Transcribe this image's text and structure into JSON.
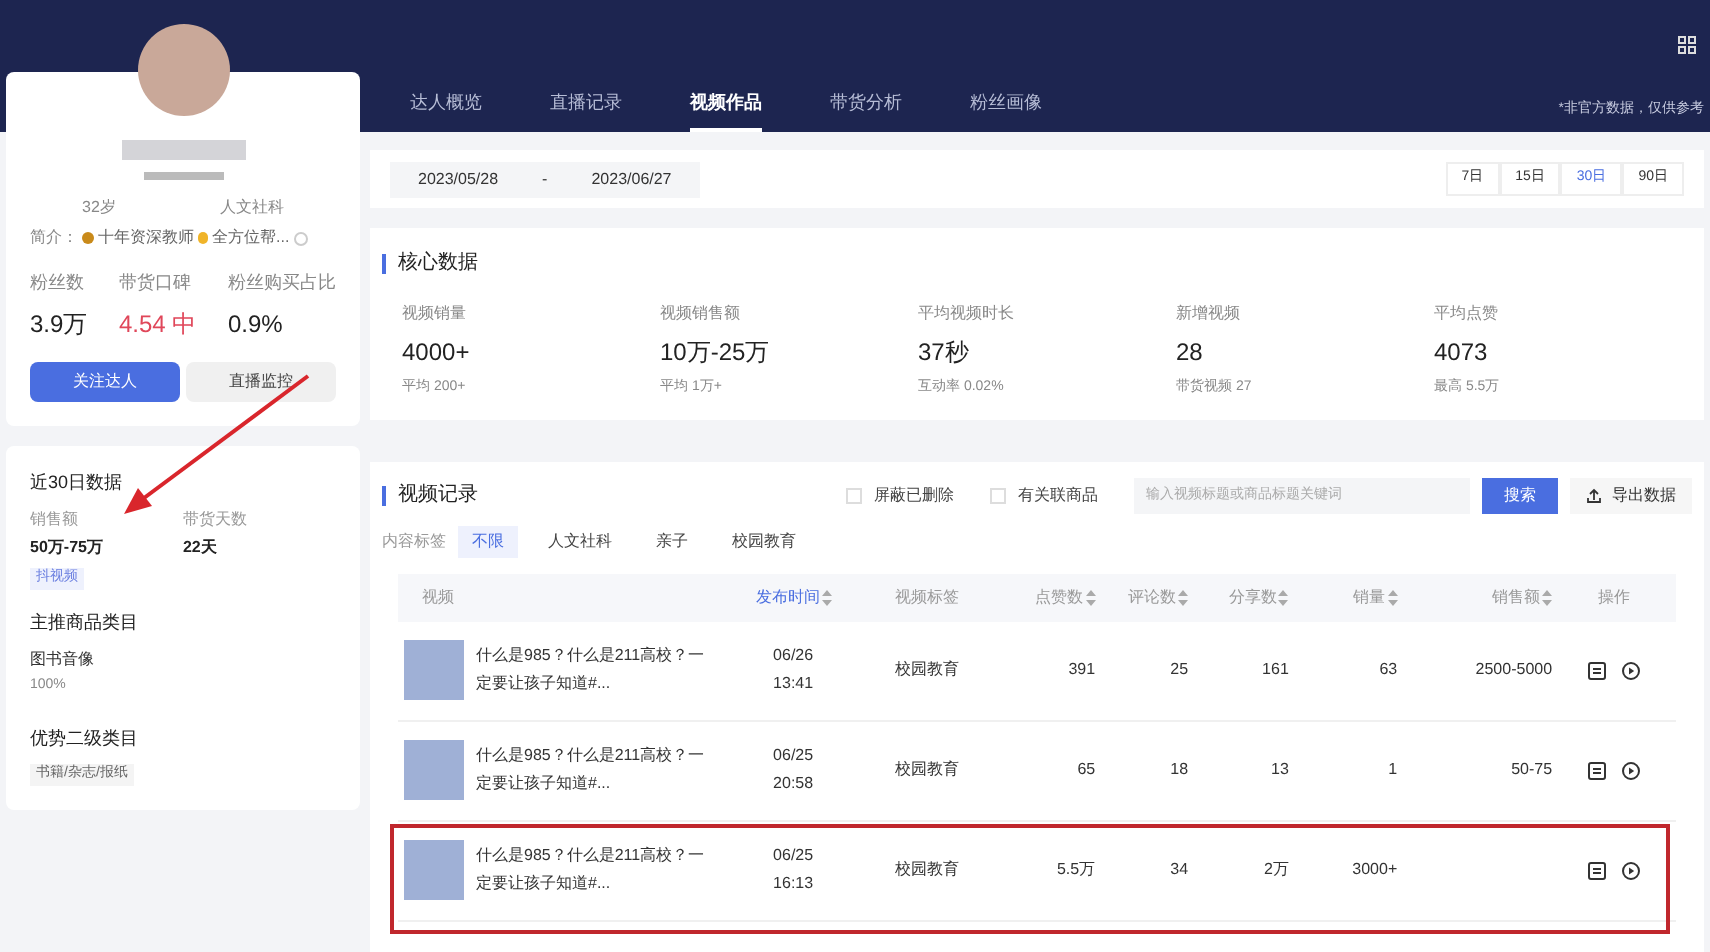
{
  "profile": {
    "age": "32岁",
    "category": "人文社科",
    "intro_label": "简介：",
    "intro": "十年资深教师",
    "intro_more": "全方位帮...",
    "stats": [
      {
        "label": "粉丝数",
        "value": "3.9万",
        "kind": "plain"
      },
      {
        "label": "带货口碑",
        "value": "4.54 中",
        "kind": "alert"
      },
      {
        "label": "粉丝购买占比",
        "value": "0.9%",
        "kind": "plain"
      }
    ],
    "buttons": [
      {
        "label": "关注达人",
        "kind": "primary"
      },
      {
        "label": "直播监控",
        "kind": "secondary"
      }
    ]
  },
  "summary": {
    "title": "近30日数据",
    "metrics": [
      {
        "label": "销售额",
        "value": "50万-75万"
      },
      {
        "label": "带货天数",
        "value": "22天"
      }
    ],
    "tag": "抖视频",
    "main_category": {
      "title": "主推商品类目",
      "name": "图书音像",
      "share": "100%"
    },
    "sub_category": {
      "title": "优势二级类目",
      "tag": "书籍/杂志/报纸"
    }
  },
  "tabs": [
    {
      "label": "达人概览",
      "selected": false
    },
    {
      "label": "直播记录",
      "selected": false
    },
    {
      "label": "视频作品",
      "selected": true
    },
    {
      "label": "带货分析",
      "selected": false
    },
    {
      "label": "粉丝画像",
      "selected": false
    }
  ],
  "disclaimer": "*非官方数据，仅供参考",
  "date_range": {
    "start": "2023/05/28",
    "separator": "-",
    "end": "2023/06/27"
  },
  "periods": [
    {
      "label": "7日",
      "selected": false
    },
    {
      "label": "15日",
      "selected": false
    },
    {
      "label": "30日",
      "selected": true
    },
    {
      "label": "90日",
      "selected": false
    }
  ],
  "core_data": {
    "title": "核心数据",
    "metrics": [
      {
        "label": "视频销量",
        "value": "4000+",
        "sub": "平均 200+"
      },
      {
        "label": "视频销售额",
        "value": "10万-25万",
        "sub": "平均 1万+"
      },
      {
        "label": "平均视频时长",
        "value": "37秒",
        "sub": "互动率 0.02%"
      },
      {
        "label": "新增视频",
        "value": "28",
        "sub": "带货视频 27"
      },
      {
        "label": "平均点赞",
        "value": "4073",
        "sub": "最高 5.5万"
      }
    ]
  },
  "video_records": {
    "title": "视频记录",
    "filters": [
      {
        "label": "屏蔽已删除",
        "checked": false
      },
      {
        "label": "有关联商品",
        "checked": false
      }
    ],
    "search": {
      "placeholder": "输入视频标题或商品标题关键词",
      "button": "搜索"
    },
    "export": "导出数据",
    "tag_filter": {
      "label": "内容标签",
      "options": [
        {
          "label": "不限",
          "selected": true
        },
        {
          "label": "人文社科",
          "selected": false
        },
        {
          "label": "亲子",
          "selected": false
        },
        {
          "label": "校园教育",
          "selected": false
        }
      ]
    },
    "columns": [
      {
        "label": "视频",
        "sortable": false,
        "selected": false
      },
      {
        "label": "发布时间",
        "sortable": true,
        "selected": true
      },
      {
        "label": "视频标签",
        "sortable": false,
        "selected": false
      },
      {
        "label": "点赞数",
        "sortable": true,
        "selected": false
      },
      {
        "label": "评论数",
        "sortable": true,
        "selected": false
      },
      {
        "label": "分享数",
        "sortable": true,
        "selected": false
      },
      {
        "label": "销量",
        "sortable": true,
        "selected": false
      },
      {
        "label": "销售额",
        "sortable": true,
        "selected": false
      },
      {
        "label": "操作",
        "sortable": false,
        "selected": false
      }
    ],
    "rows": [
      {
        "title": "什么是985？什么是211高校？一定要让孩子知道#...",
        "date": "06/26",
        "time": "13:41",
        "tag": "校园教育",
        "likes": "391",
        "comments": "25",
        "shares": "161",
        "sales": "63",
        "revenue": "2500-5000",
        "highlighted": false
      },
      {
        "title": "什么是985？什么是211高校？一定要让孩子知道#...",
        "date": "06/25",
        "time": "20:58",
        "tag": "校园教育",
        "likes": "65",
        "comments": "18",
        "shares": "13",
        "sales": "1",
        "revenue": "50-75",
        "highlighted": false
      },
      {
        "title": "什么是985？什么是211高校？一定要让孩子知道#...",
        "date": "06/25",
        "time": "16:13",
        "tag": "校园教育",
        "likes": "5.5万",
        "comments": "34",
        "shares": "2万",
        "sales": "3000+",
        "highlighted": true
      }
    ]
  }
}
